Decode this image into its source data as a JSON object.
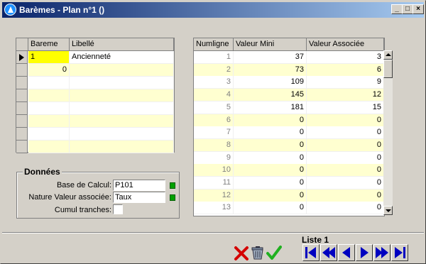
{
  "window": {
    "title": "Barèmes - Plan n°1 ()"
  },
  "left_grid": {
    "columns": [
      "Bareme",
      "Libellé"
    ],
    "rows": [
      {
        "bareme": "1",
        "libelle": "Ancienneté",
        "current": true
      },
      {
        "bareme": "0",
        "libelle": ""
      },
      {
        "bareme": "",
        "libelle": ""
      },
      {
        "bareme": "",
        "libelle": ""
      },
      {
        "bareme": "",
        "libelle": ""
      },
      {
        "bareme": "",
        "libelle": ""
      },
      {
        "bareme": "",
        "libelle": ""
      },
      {
        "bareme": "",
        "libelle": ""
      }
    ]
  },
  "right_grid": {
    "columns": [
      "Numligne",
      "Valeur Mini",
      "Valeur Associée"
    ],
    "rows": [
      {
        "numligne": "1",
        "mini": "37",
        "assoc": "3"
      },
      {
        "numligne": "2",
        "mini": "73",
        "assoc": "6"
      },
      {
        "numligne": "3",
        "mini": "109",
        "assoc": "9"
      },
      {
        "numligne": "4",
        "mini": "145",
        "assoc": "12"
      },
      {
        "numligne": "5",
        "mini": "181",
        "assoc": "15"
      },
      {
        "numligne": "6",
        "mini": "0",
        "assoc": "0"
      },
      {
        "numligne": "7",
        "mini": "0",
        "assoc": "0"
      },
      {
        "numligne": "8",
        "mini": "0",
        "assoc": "0"
      },
      {
        "numligne": "9",
        "mini": "0",
        "assoc": "0"
      },
      {
        "numligne": "10",
        "mini": "0",
        "assoc": "0"
      },
      {
        "numligne": "11",
        "mini": "0",
        "assoc": "0"
      },
      {
        "numligne": "12",
        "mini": "0",
        "assoc": "0"
      },
      {
        "numligne": "13",
        "mini": "0",
        "assoc": "0"
      }
    ]
  },
  "donnees": {
    "legend": "Données",
    "base_calcul_label": "Base de Calcul:",
    "base_calcul_value": "P101",
    "nature_label": "Nature Valeur associée:",
    "nature_value": "Taux",
    "cumul_label": "Cumul tranches:"
  },
  "toolbar": {
    "liste_label": "Liste 1",
    "icons": [
      "cancel-icon",
      "trash-icon",
      "validate-icon",
      "first-icon",
      "previous-page-icon",
      "previous-icon",
      "next-icon",
      "next-page-icon",
      "last-icon"
    ]
  },
  "colors": {
    "title_gradient_start": "#0a246a",
    "title_gradient_end": "#a6caf0",
    "row_alt_yellow": "#ffffd0",
    "selected_cell": "#ffff00",
    "nav_blue": "#0000c0"
  }
}
